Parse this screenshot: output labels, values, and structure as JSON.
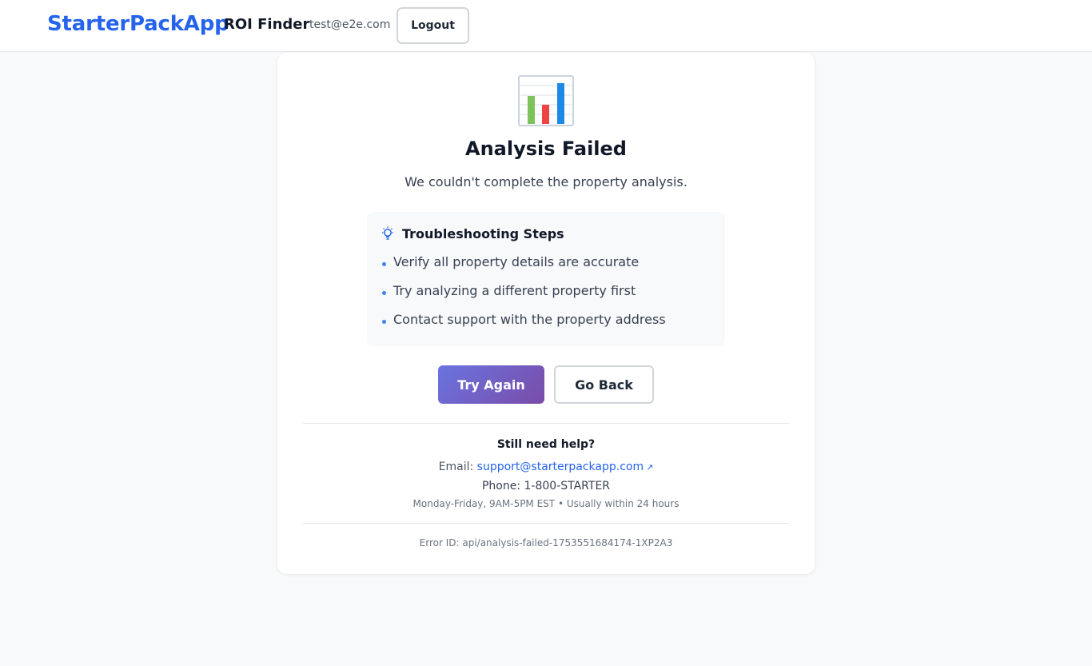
{
  "header": {
    "brand": "StarterPackApp",
    "product": "ROI Finder",
    "user_email": "test@e2e.com",
    "logout_label": "Logout"
  },
  "error_card": {
    "icon": "bar-chart-icon",
    "title": "Analysis Failed",
    "subtitle": "We couldn't complete the property analysis.",
    "troubleshooting": {
      "icon": "lightbulb-icon",
      "title": "Troubleshooting Steps",
      "steps": [
        "Verify all property details are accurate",
        "Try analyzing a different property first",
        "Contact support with the property address"
      ]
    },
    "try_again_label": "Try Again",
    "go_back_label": "Go Back",
    "help": {
      "title": "Still need help?",
      "email_prefix": "Email:",
      "email": "support@starterpackapp.com",
      "phone": "Phone: 1-800-STARTER",
      "hours": "Monday-Friday, 9AM-5PM EST • Usually within 24 hours"
    },
    "error_id": "Error ID: api/analysis-failed-1753551684174-1XP2A3"
  },
  "colors": {
    "brand": "#2563eb",
    "primary_gradient_start": "#6a74e0",
    "primary_gradient_end": "#7a4ca8",
    "page_background": "#f8f9fb"
  }
}
